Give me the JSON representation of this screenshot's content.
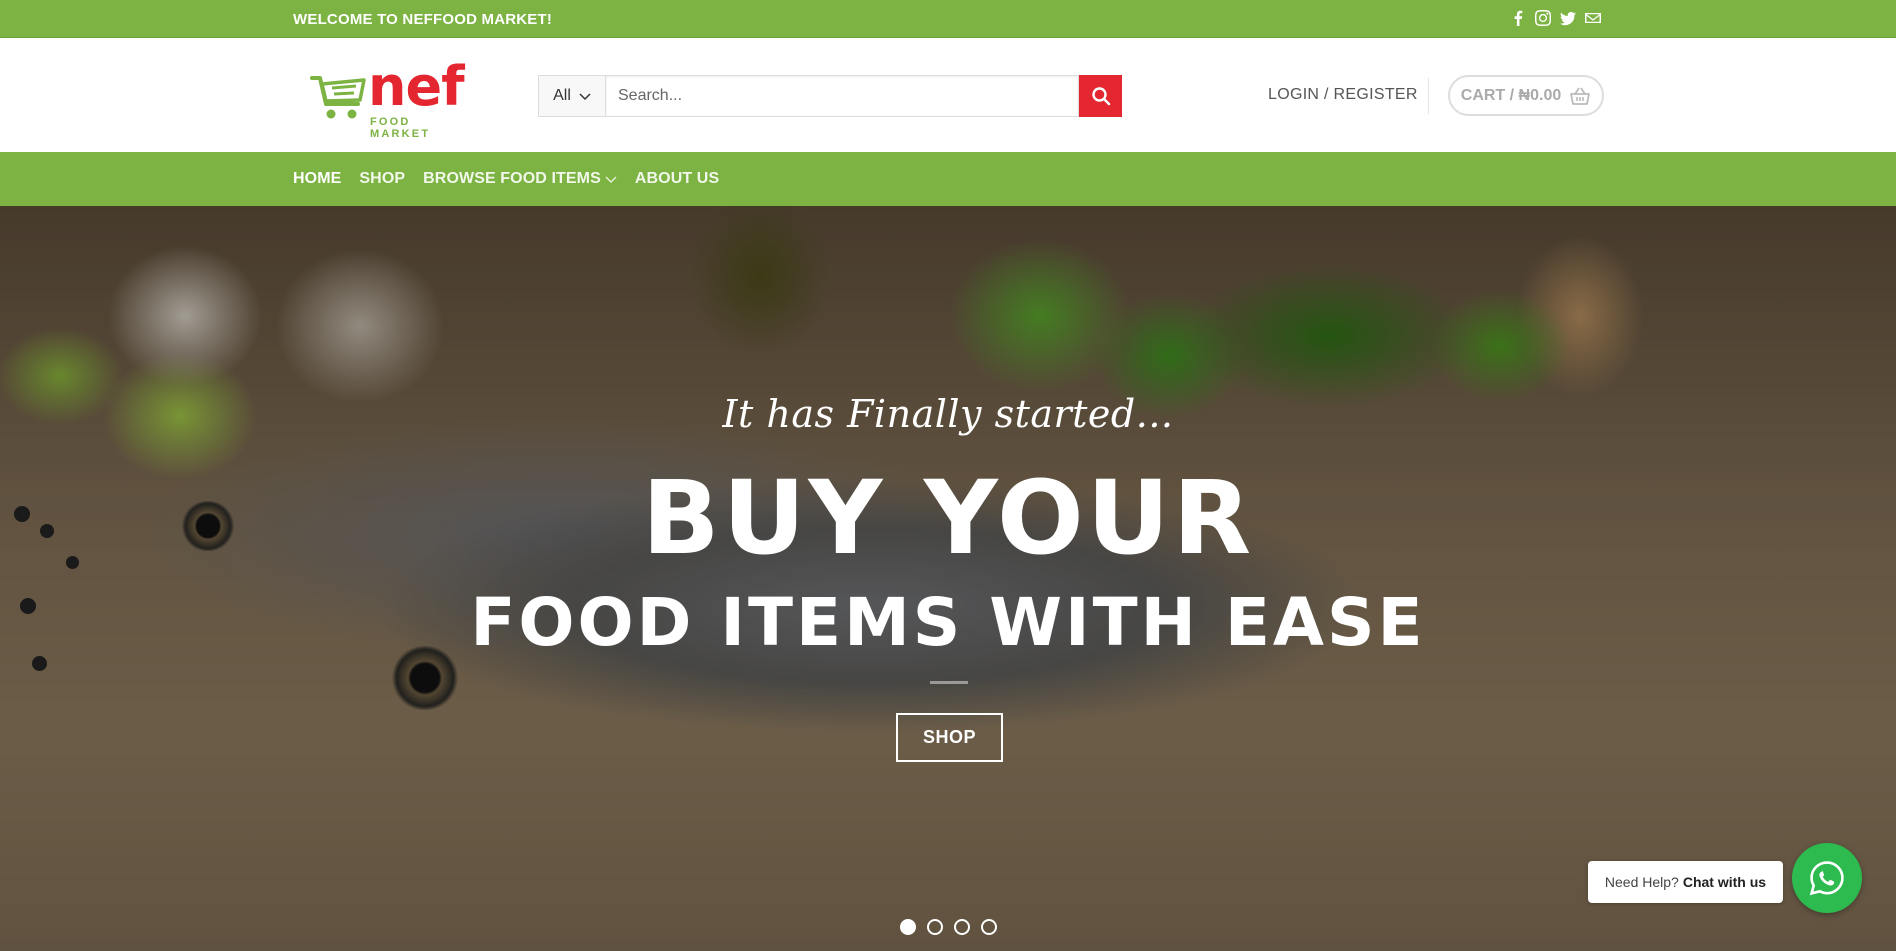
{
  "topbar": {
    "welcome": "WELCOME TO NEFFOOD MARKET!",
    "socials": [
      "facebook-icon",
      "instagram-icon",
      "twitter-icon",
      "email-icon"
    ]
  },
  "header": {
    "logo_word": "nef",
    "logo_sub": "FOOD MARKET",
    "search": {
      "category": "All",
      "placeholder": "Search..."
    },
    "login_label": "LOGIN / REGISTER",
    "cart_label": "CART / ₦0.00"
  },
  "nav": {
    "items": [
      {
        "label": "HOME",
        "active": true
      },
      {
        "label": "SHOP"
      },
      {
        "label": "BROWSE FOOD ITEMS",
        "has_dropdown": true
      },
      {
        "label": "ABOUT US"
      }
    ]
  },
  "hero": {
    "tagline": "It has Finally started...",
    "headline1": "BUY YOUR",
    "headline2": "FOOD ITEMS WITH EASE",
    "button_label": "SHOP",
    "slides": 4,
    "active_slide": 1
  },
  "chat": {
    "prefix": "Need Help?",
    "action": "Chat with us"
  },
  "colors": {
    "brand_green": "#7cb342",
    "brand_red": "#e3262f",
    "whatsapp_green": "#2dbb4f"
  }
}
